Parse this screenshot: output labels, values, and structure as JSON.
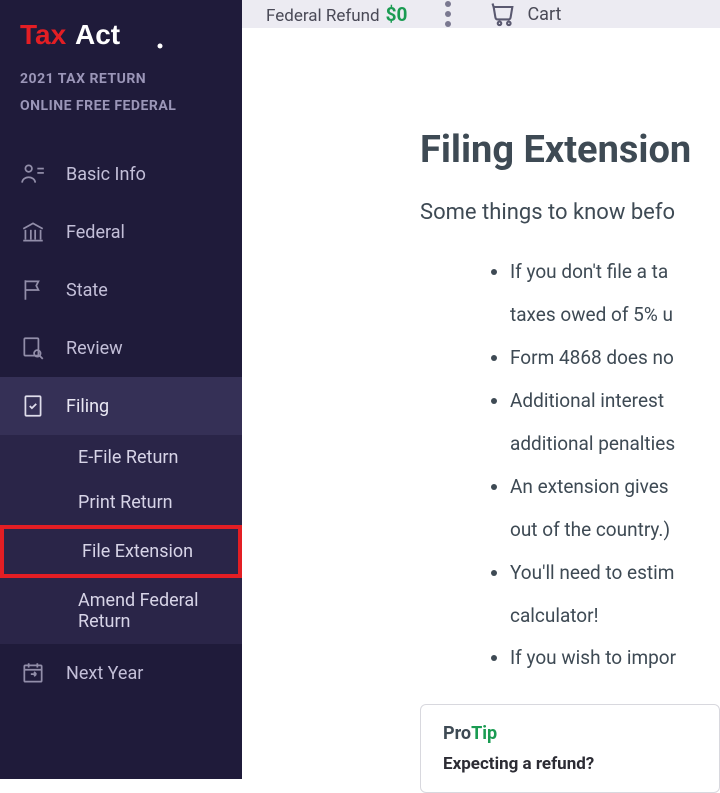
{
  "brand": {
    "name": "TaxAct",
    "accent": "#e31e24"
  },
  "meta": {
    "year": "2021 TAX RETURN",
    "product": "ONLINE FREE FEDERAL"
  },
  "nav": {
    "items": [
      {
        "label": "Basic Info"
      },
      {
        "label": "Federal"
      },
      {
        "label": "State"
      },
      {
        "label": "Review"
      },
      {
        "label": "Filing"
      },
      {
        "label": "Next Year"
      }
    ],
    "filing_sub": [
      {
        "label": "E-File Return"
      },
      {
        "label": "Print Return"
      },
      {
        "label": "File Extension"
      },
      {
        "label": "Amend Federal Return"
      }
    ]
  },
  "topbar": {
    "refund_label": "Federal Refund",
    "refund_amount": "$0",
    "cart_label": "Cart"
  },
  "content": {
    "heading": "Filing Extension",
    "subheading": "Some things to know befo",
    "bullets": [
      "If you don't file a ta",
      "taxes owed of 5% u",
      "Form 4868 does no",
      "Additional interest ",
      "additional penalties",
      "An extension gives ",
      "out of the country.)",
      "You'll need to estim",
      "calculator!",
      "If you wish to impor"
    ],
    "protip": {
      "label_pro": "Pro",
      "label_tip": "Tip",
      "subtitle": "Expecting a refund?"
    }
  }
}
